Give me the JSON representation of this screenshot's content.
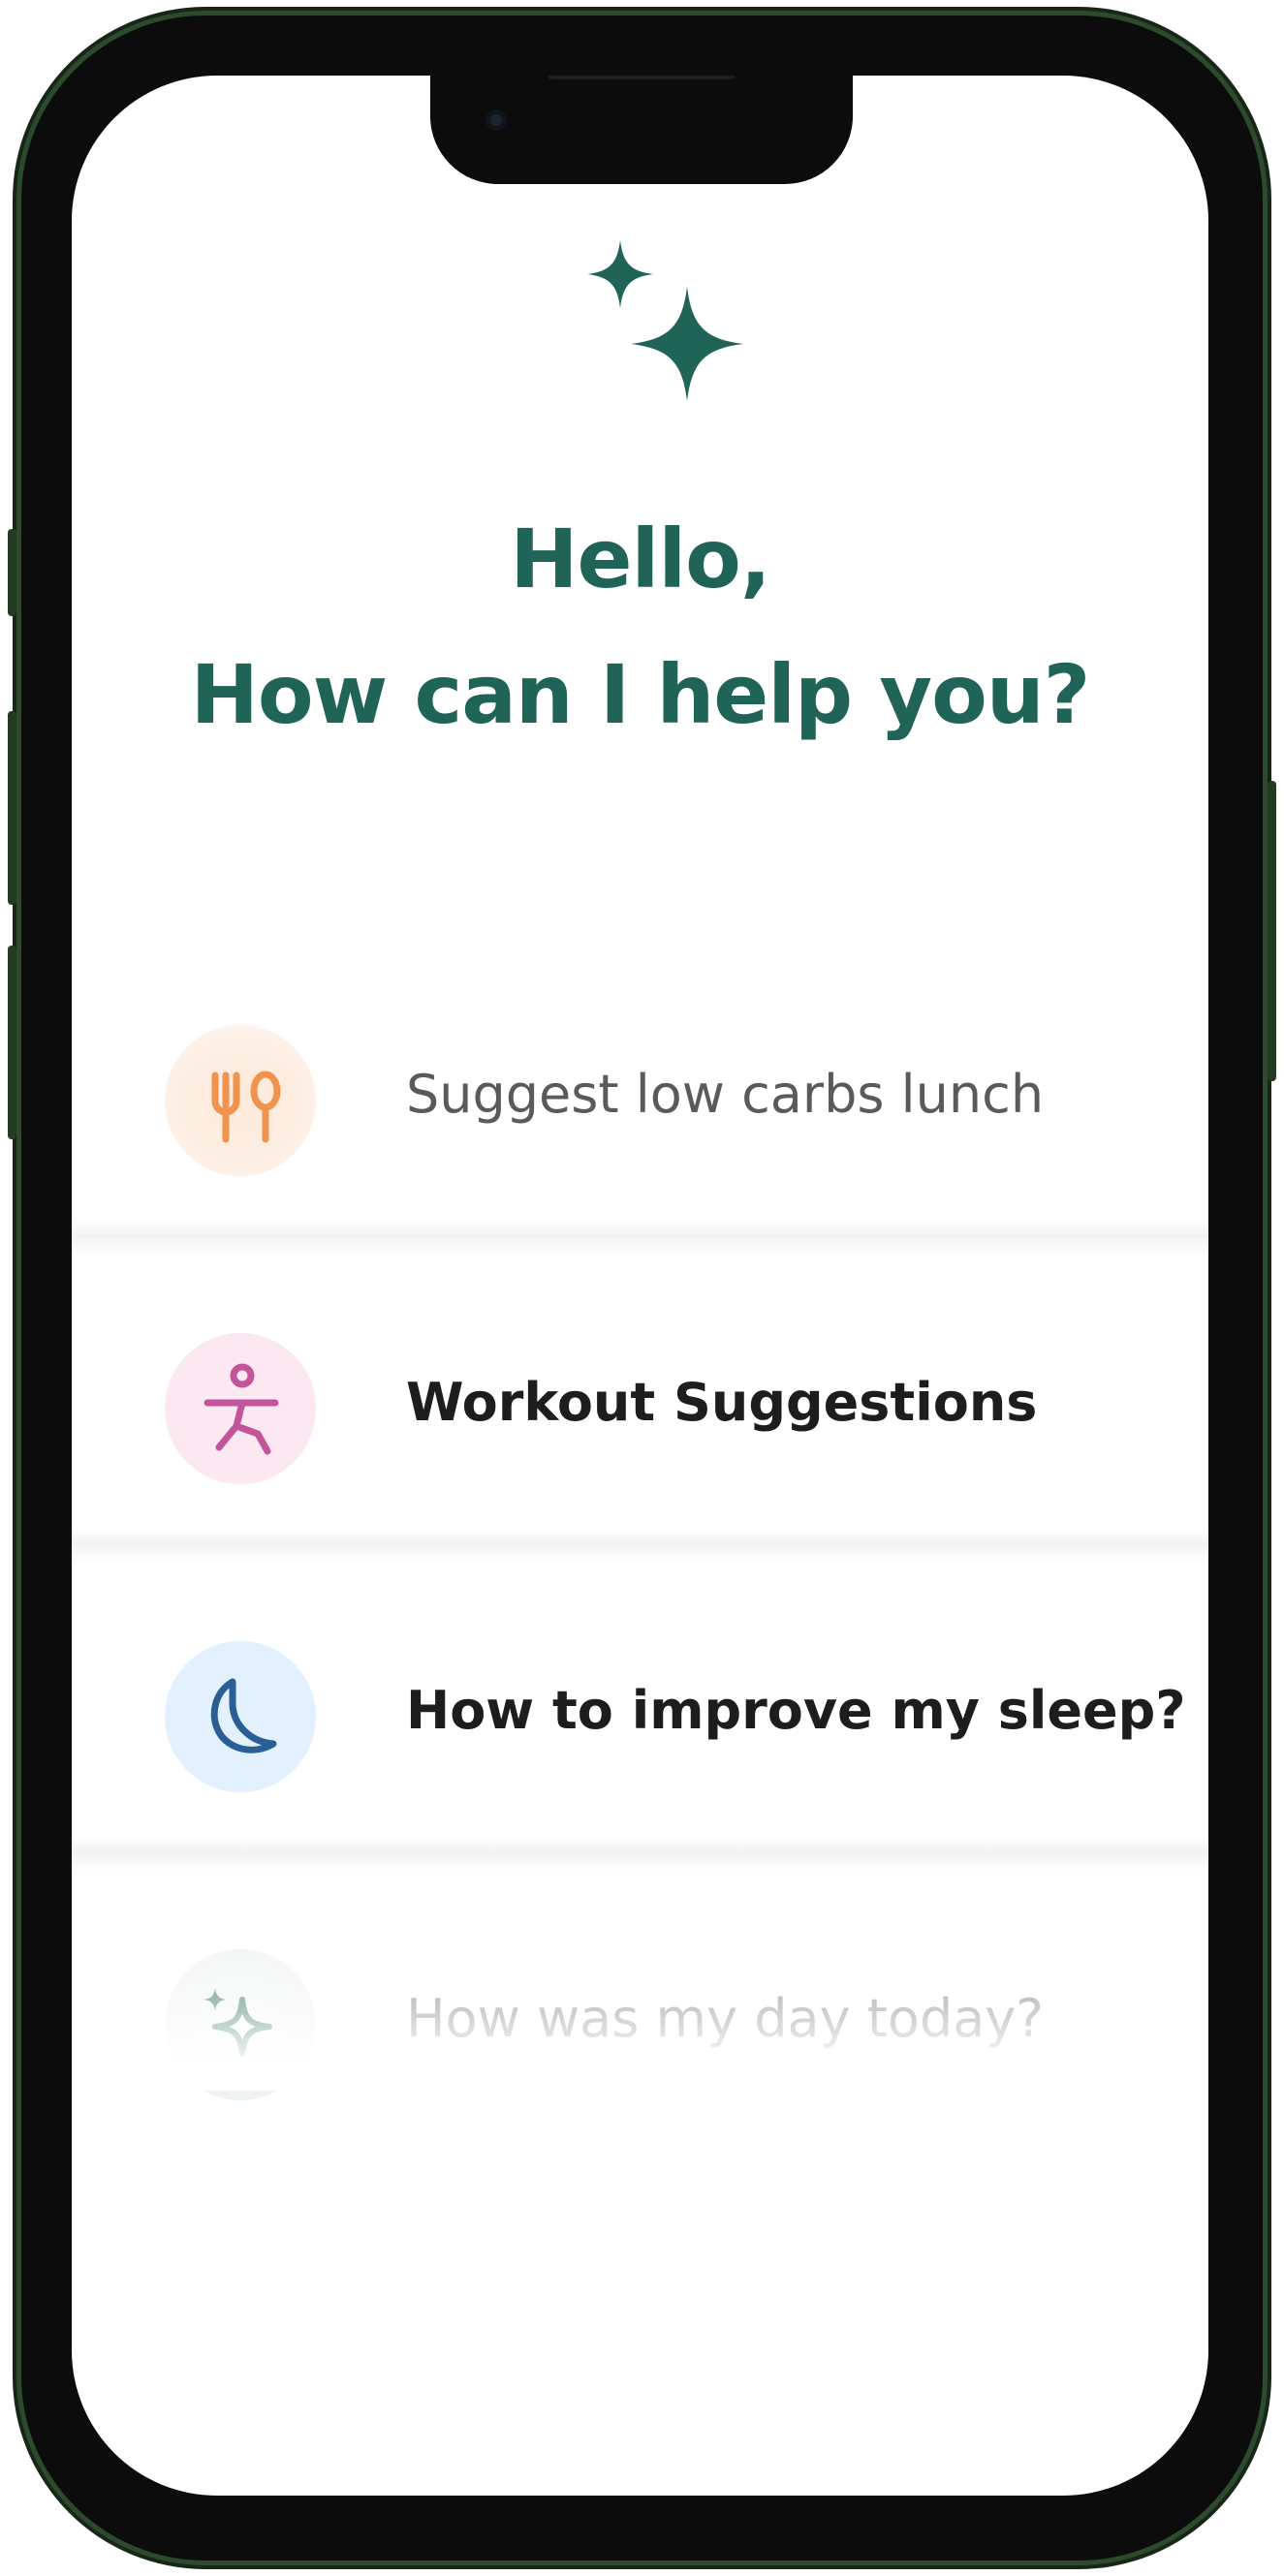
{
  "assistant": {
    "greeting_line1": "Hello,",
    "greeting_line2": "How can I help you?",
    "accent_color": "#1f6456"
  },
  "suggestions": [
    {
      "label": "Suggest low carbs lunch",
      "icon": "fork-spoon-icon",
      "color": "#f0934f",
      "bg": "#fdeee2"
    },
    {
      "label": "Workout Suggestions",
      "icon": "exercise-figure-icon",
      "color": "#c2549a",
      "bg": "#fbe8f1"
    },
    {
      "label": "How to improve my sleep?",
      "icon": "moon-icon",
      "color": "#2a5f96",
      "bg": "#e3f0fd"
    },
    {
      "label": "How was my day today?",
      "icon": "sparkle-icon",
      "color": "#1f6456",
      "bg": "#eef3f1"
    }
  ]
}
